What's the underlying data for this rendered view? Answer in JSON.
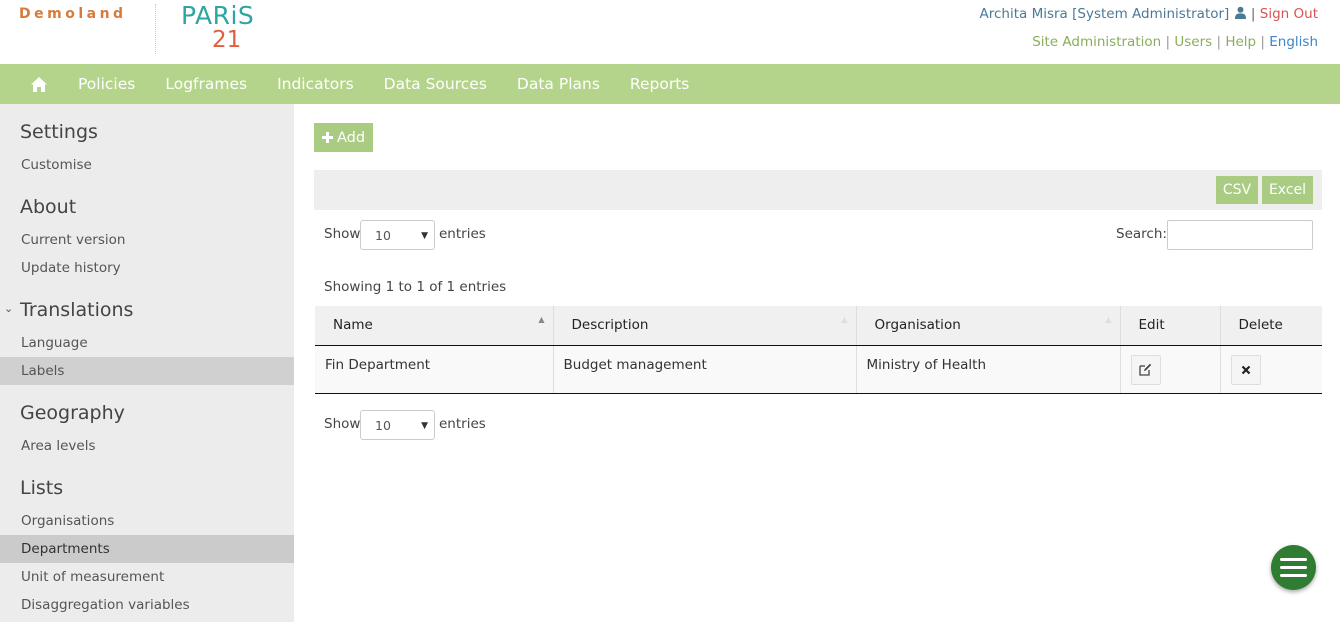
{
  "header": {
    "brand": "Demoland",
    "logo_top": "PARiS",
    "logo_bottom": "21",
    "user": "Archita Misra [System Administrator]",
    "sign_out": "Sign Out",
    "admin_links": [
      "Site Administration",
      "Users",
      "Help"
    ],
    "language": "English"
  },
  "nav": {
    "items": [
      "Policies",
      "Logframes",
      "Indicators",
      "Data Sources",
      "Data Plans",
      "Reports"
    ]
  },
  "sidebar": {
    "settings": "Settings",
    "customise": "Customise",
    "about": "About",
    "current_version": "Current version",
    "update_history": "Update history",
    "translations": "Translations",
    "language": "Language",
    "labels": "Labels",
    "geography": "Geography",
    "area_levels": "Area levels",
    "lists": "Lists",
    "organisations": "Organisations",
    "departments": "Departments",
    "unit_of_measurement": "Unit of measurement",
    "disaggregation_variables": "Disaggregation variables"
  },
  "main": {
    "add_label": "Add",
    "csv_label": "CSV",
    "excel_label": "Excel",
    "show_label": "Show",
    "entries_label": "entries",
    "page_length": "10",
    "search_label": "Search:",
    "info": "Showing 1 to 1 of 1 entries",
    "columns": [
      "Name",
      "Description",
      "Organisation",
      "Edit",
      "Delete"
    ],
    "rows": [
      {
        "name": "Fin Department",
        "description": "Budget management",
        "organisation": "Ministry of Health"
      }
    ]
  },
  "colors": {
    "nav_bg": "#b3d48a",
    "button_bg": "#a9cc82",
    "fab_bg": "#2e7d32",
    "sign_out": "#d9534f"
  }
}
